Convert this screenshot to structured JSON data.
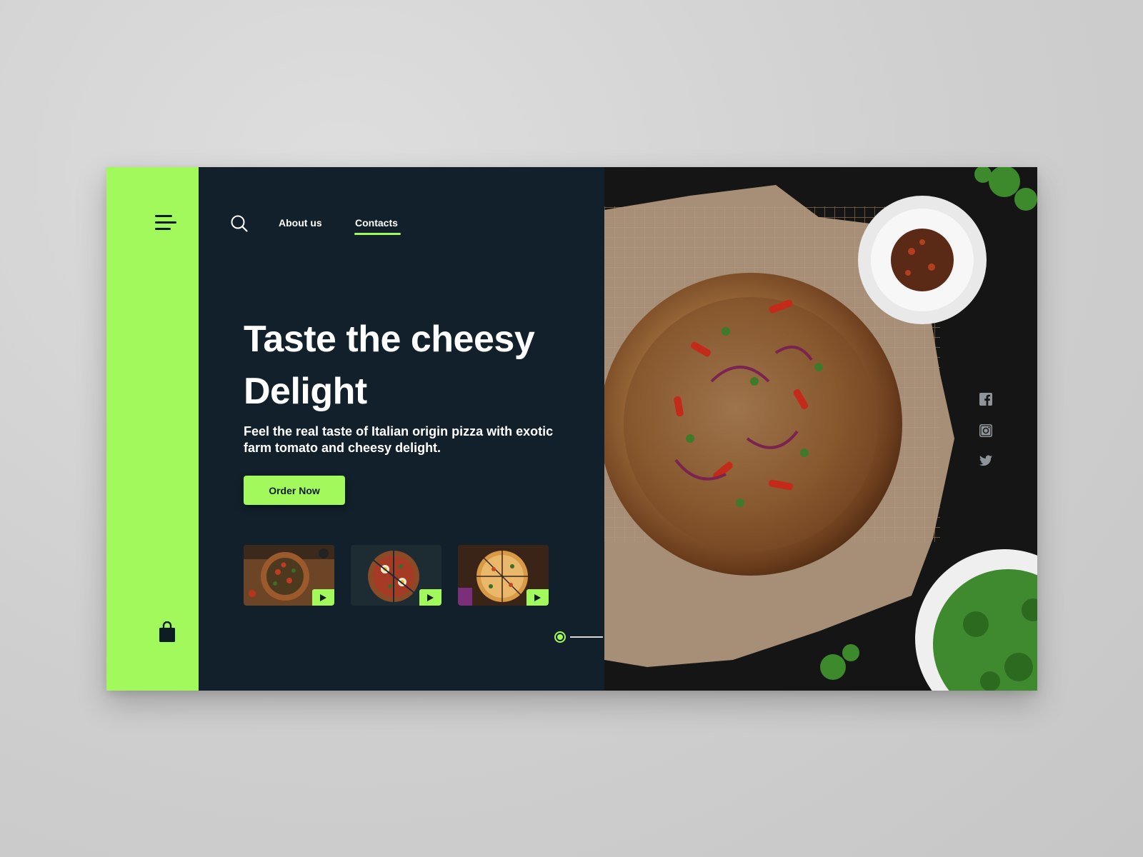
{
  "nav": {
    "about_label": "About us",
    "contacts_label": "Contacts",
    "active": "Contacts"
  },
  "hero": {
    "title": "Taste the cheesy Delight",
    "subtitle": "Feel the real taste of Italian origin pizza with exotic farm tomato and cheesy delight.",
    "cta_label": "Order Now"
  },
  "thumbnails": [
    {
      "icon": "play-icon"
    },
    {
      "icon": "play-icon"
    },
    {
      "icon": "play-icon"
    }
  ],
  "pager": {
    "pages": 3,
    "active_index": 0
  },
  "social": [
    "facebook-icon",
    "instagram-icon",
    "twitter-icon"
  ],
  "icons": {
    "menu": "menu-icon",
    "search": "search-icon",
    "cart": "shopping-bag-icon"
  },
  "colors": {
    "accent": "#a2f95c",
    "panel": "#11202a",
    "background": "#cfcfcf",
    "text": "#ffffff"
  }
}
